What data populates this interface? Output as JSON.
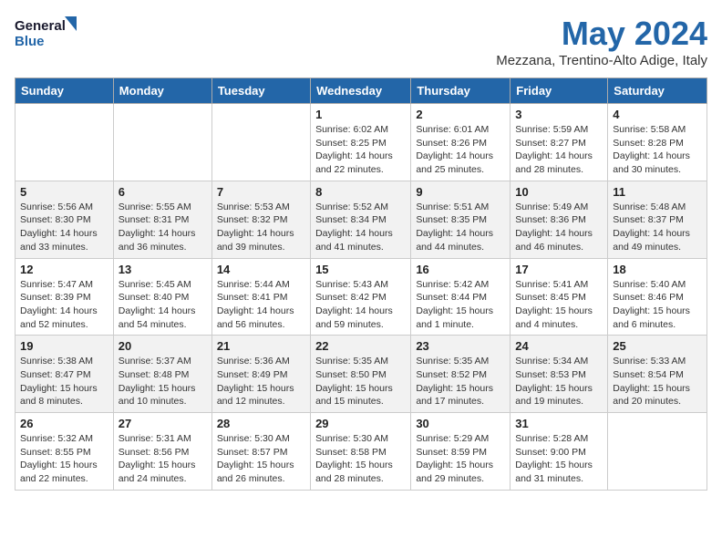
{
  "logo": {
    "line1": "General",
    "line2": "Blue"
  },
  "title": "May 2024",
  "location": "Mezzana, Trentino-Alto Adige, Italy",
  "weekdays": [
    "Sunday",
    "Monday",
    "Tuesday",
    "Wednesday",
    "Thursday",
    "Friday",
    "Saturday"
  ],
  "weeks": [
    [
      {
        "day": "",
        "detail": ""
      },
      {
        "day": "",
        "detail": ""
      },
      {
        "day": "",
        "detail": ""
      },
      {
        "day": "1",
        "detail": "Sunrise: 6:02 AM\nSunset: 8:25 PM\nDaylight: 14 hours\nand 22 minutes."
      },
      {
        "day": "2",
        "detail": "Sunrise: 6:01 AM\nSunset: 8:26 PM\nDaylight: 14 hours\nand 25 minutes."
      },
      {
        "day": "3",
        "detail": "Sunrise: 5:59 AM\nSunset: 8:27 PM\nDaylight: 14 hours\nand 28 minutes."
      },
      {
        "day": "4",
        "detail": "Sunrise: 5:58 AM\nSunset: 8:28 PM\nDaylight: 14 hours\nand 30 minutes."
      }
    ],
    [
      {
        "day": "5",
        "detail": "Sunrise: 5:56 AM\nSunset: 8:30 PM\nDaylight: 14 hours\nand 33 minutes."
      },
      {
        "day": "6",
        "detail": "Sunrise: 5:55 AM\nSunset: 8:31 PM\nDaylight: 14 hours\nand 36 minutes."
      },
      {
        "day": "7",
        "detail": "Sunrise: 5:53 AM\nSunset: 8:32 PM\nDaylight: 14 hours\nand 39 minutes."
      },
      {
        "day": "8",
        "detail": "Sunrise: 5:52 AM\nSunset: 8:34 PM\nDaylight: 14 hours\nand 41 minutes."
      },
      {
        "day": "9",
        "detail": "Sunrise: 5:51 AM\nSunset: 8:35 PM\nDaylight: 14 hours\nand 44 minutes."
      },
      {
        "day": "10",
        "detail": "Sunrise: 5:49 AM\nSunset: 8:36 PM\nDaylight: 14 hours\nand 46 minutes."
      },
      {
        "day": "11",
        "detail": "Sunrise: 5:48 AM\nSunset: 8:37 PM\nDaylight: 14 hours\nand 49 minutes."
      }
    ],
    [
      {
        "day": "12",
        "detail": "Sunrise: 5:47 AM\nSunset: 8:39 PM\nDaylight: 14 hours\nand 52 minutes."
      },
      {
        "day": "13",
        "detail": "Sunrise: 5:45 AM\nSunset: 8:40 PM\nDaylight: 14 hours\nand 54 minutes."
      },
      {
        "day": "14",
        "detail": "Sunrise: 5:44 AM\nSunset: 8:41 PM\nDaylight: 14 hours\nand 56 minutes."
      },
      {
        "day": "15",
        "detail": "Sunrise: 5:43 AM\nSunset: 8:42 PM\nDaylight: 14 hours\nand 59 minutes."
      },
      {
        "day": "16",
        "detail": "Sunrise: 5:42 AM\nSunset: 8:44 PM\nDaylight: 15 hours\nand 1 minute."
      },
      {
        "day": "17",
        "detail": "Sunrise: 5:41 AM\nSunset: 8:45 PM\nDaylight: 15 hours\nand 4 minutes."
      },
      {
        "day": "18",
        "detail": "Sunrise: 5:40 AM\nSunset: 8:46 PM\nDaylight: 15 hours\nand 6 minutes."
      }
    ],
    [
      {
        "day": "19",
        "detail": "Sunrise: 5:38 AM\nSunset: 8:47 PM\nDaylight: 15 hours\nand 8 minutes."
      },
      {
        "day": "20",
        "detail": "Sunrise: 5:37 AM\nSunset: 8:48 PM\nDaylight: 15 hours\nand 10 minutes."
      },
      {
        "day": "21",
        "detail": "Sunrise: 5:36 AM\nSunset: 8:49 PM\nDaylight: 15 hours\nand 12 minutes."
      },
      {
        "day": "22",
        "detail": "Sunrise: 5:35 AM\nSunset: 8:50 PM\nDaylight: 15 hours\nand 15 minutes."
      },
      {
        "day": "23",
        "detail": "Sunrise: 5:35 AM\nSunset: 8:52 PM\nDaylight: 15 hours\nand 17 minutes."
      },
      {
        "day": "24",
        "detail": "Sunrise: 5:34 AM\nSunset: 8:53 PM\nDaylight: 15 hours\nand 19 minutes."
      },
      {
        "day": "25",
        "detail": "Sunrise: 5:33 AM\nSunset: 8:54 PM\nDaylight: 15 hours\nand 20 minutes."
      }
    ],
    [
      {
        "day": "26",
        "detail": "Sunrise: 5:32 AM\nSunset: 8:55 PM\nDaylight: 15 hours\nand 22 minutes."
      },
      {
        "day": "27",
        "detail": "Sunrise: 5:31 AM\nSunset: 8:56 PM\nDaylight: 15 hours\nand 24 minutes."
      },
      {
        "day": "28",
        "detail": "Sunrise: 5:30 AM\nSunset: 8:57 PM\nDaylight: 15 hours\nand 26 minutes."
      },
      {
        "day": "29",
        "detail": "Sunrise: 5:30 AM\nSunset: 8:58 PM\nDaylight: 15 hours\nand 28 minutes."
      },
      {
        "day": "30",
        "detail": "Sunrise: 5:29 AM\nSunset: 8:59 PM\nDaylight: 15 hours\nand 29 minutes."
      },
      {
        "day": "31",
        "detail": "Sunrise: 5:28 AM\nSunset: 9:00 PM\nDaylight: 15 hours\nand 31 minutes."
      },
      {
        "day": "",
        "detail": ""
      }
    ]
  ]
}
